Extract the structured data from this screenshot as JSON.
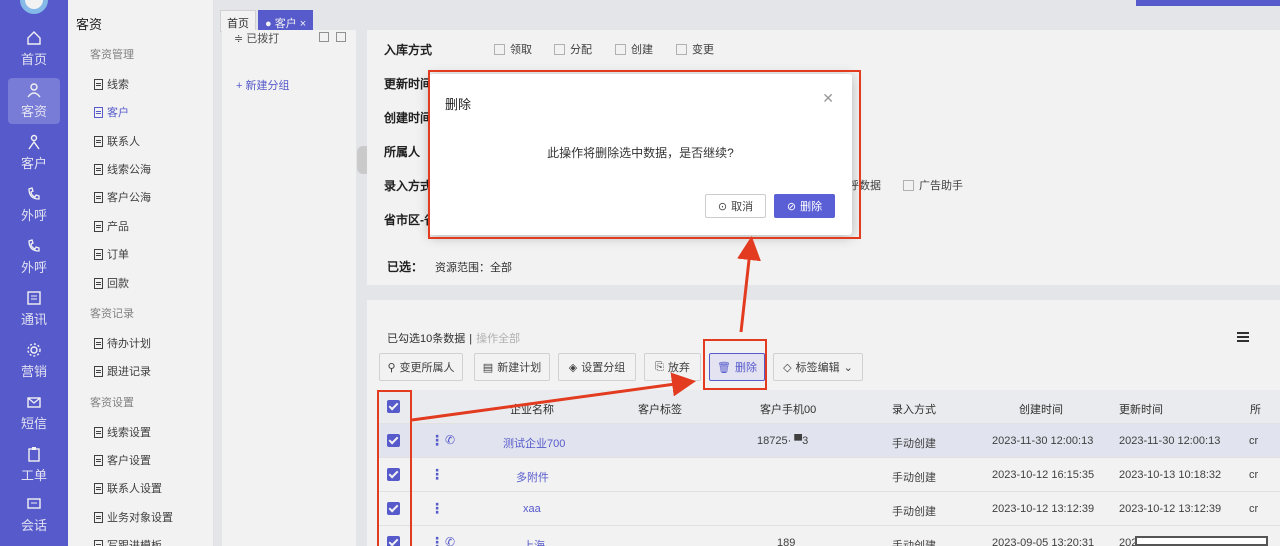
{
  "rail": [
    {
      "label": "首页",
      "icon": "home-icon"
    },
    {
      "label": "客资",
      "icon": "users-icon",
      "active": true
    },
    {
      "label": "客户",
      "icon": "person-icon"
    },
    {
      "label": "外呼",
      "icon": "phone-out-icon"
    },
    {
      "label": "外呼",
      "icon": "phone-call-icon"
    },
    {
      "label": "通讯",
      "icon": "calendar-icon"
    },
    {
      "label": "营销",
      "icon": "gear-icon"
    },
    {
      "label": "短信",
      "icon": "mail-icon"
    },
    {
      "label": "工单",
      "icon": "clipboard-icon"
    },
    {
      "label": "会话",
      "icon": "chat-icon"
    }
  ],
  "menu": {
    "title": "客资",
    "group1": "客资管理",
    "items1": [
      "线索",
      "客户",
      "联系人",
      "线索公海",
      "客户公海",
      "产品",
      "订单",
      "回款"
    ],
    "active_item": "客户",
    "group2": "客资记录",
    "items2": [
      "待办计划",
      "跟进记录"
    ],
    "group3": "客资设置",
    "items3": [
      "线索设置",
      "客户设置",
      "联系人设置",
      "业务对象设置",
      "写跟进模板"
    ]
  },
  "tabs": {
    "home": "首页",
    "current": "● 客户 ×"
  },
  "group_panel": {
    "row1": "≑ 已拨打",
    "new_group": "+ 新建分组"
  },
  "filter": {
    "labels": [
      "入库方式",
      "更新时间",
      "创建时间",
      "所属人",
      "录入方式",
      "省市区-省"
    ],
    "storage_options": [
      "领取",
      "分配",
      "创建",
      "变更"
    ],
    "entry_options": [
      "呼数据",
      "广告助手"
    ],
    "selected_label": "已选：",
    "selected_value": "资源范围：全部"
  },
  "table": {
    "selected_info": "已勾选10条数据",
    "select_all": "操作全部",
    "buttons": [
      "变更所属人",
      "新建计划",
      "设置分组",
      "放弃",
      "删除",
      "标签编辑"
    ],
    "headers": [
      "企业名称",
      "客户标签",
      "客户手机00",
      "录入方式",
      "创建时间",
      "更新时间",
      "所"
    ],
    "rows": [
      {
        "name": "测试企业700",
        "phone": "18725· ▀3",
        "entry": "手动创建",
        "created": "2023-11-30 12:00:13",
        "updated": "2023-11-30 12:00:13",
        "owner": "cr"
      },
      {
        "name": "多附件",
        "phone": "",
        "entry": "手动创建",
        "created": "2023-10-12 16:15:35",
        "updated": "2023-10-13 10:18:32",
        "owner": "cr"
      },
      {
        "name": "xaa",
        "phone": "",
        "entry": "手动创建",
        "created": "2023-10-12 13:12:39",
        "updated": "2023-10-12 13:12:39",
        "owner": "cr"
      },
      {
        "name": "上海",
        "phone": "189",
        "entry": "手动创建",
        "created": "2023-09-05 13:20:31",
        "updated": "202",
        "owner": ""
      }
    ]
  },
  "dialog": {
    "title": "删除",
    "message": "此操作将删除选中数据，是否继续?",
    "cancel": "取消",
    "confirm": "删除"
  },
  "colors": {
    "primary": "#5b5fd6",
    "annotation": "#e23b20"
  }
}
